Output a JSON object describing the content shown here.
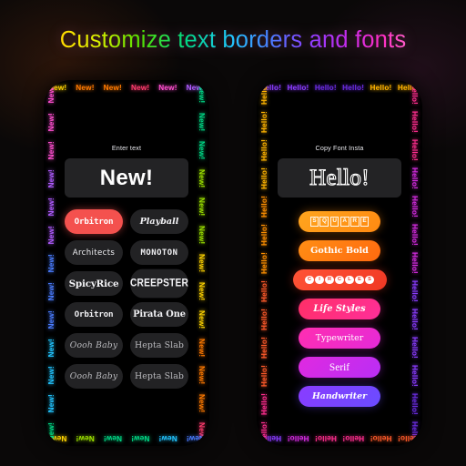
{
  "background_color": "#0a0808",
  "headline": "Customize text borders and fonts",
  "headline_gradient": [
    "#ff5a00",
    "#ffe000",
    "#55e000",
    "#22c4ff",
    "#8a40ff",
    "#ff2ec4",
    "#ffffff"
  ],
  "phones": [
    {
      "name": "left-phone",
      "border_word": "New!",
      "border_palette": [
        "#ff4fd0",
        "#b05cff",
        "#4a7cff",
        "#22c4ff",
        "#00d886",
        "#9be000",
        "#ffd400",
        "#ff7a00",
        "#ff3c6e"
      ],
      "field_label": "Enter text",
      "preview_text": "New!",
      "preview_style": "solid-white",
      "selected_font": "Orbitron",
      "selected_color": "#f4514e",
      "fonts": [
        {
          "label": "Orbitron",
          "style": "f-orbitron",
          "selected": true
        },
        {
          "label": "Playball",
          "style": "f-playball",
          "selected": false
        },
        {
          "label": "Architects",
          "style": "f-architects",
          "selected": false
        },
        {
          "label": "MONOTON",
          "style": "f-monoton",
          "selected": false
        },
        {
          "label": "SpicyRice",
          "style": "f-spicyrice",
          "selected": false
        },
        {
          "label": "CREEPSTER",
          "style": "f-creepster",
          "selected": false
        },
        {
          "label": "Orbitron",
          "style": "f-orbitron",
          "selected": false
        },
        {
          "label": "Pirata One",
          "style": "f-pirata",
          "selected": false
        },
        {
          "label": "Oooh Baby",
          "style": "f-oooh",
          "selected": false
        },
        {
          "label": "Hepta Slab",
          "style": "f-hepta",
          "selected": false
        },
        {
          "label": "Oooh Baby",
          "style": "f-oooh",
          "selected": false
        },
        {
          "label": "Hepta Slab",
          "style": "f-hepta",
          "selected": false
        }
      ]
    },
    {
      "name": "right-phone",
      "border_word": "Hello!",
      "border_palette": [
        "#ffb400",
        "#ff9000",
        "#ff5a2a",
        "#ff2e8e",
        "#d42ce0",
        "#8a3cff",
        "#6a2ce0"
      ],
      "field_label": "Copy Font Insta",
      "preview_text": "Hello!",
      "preview_style": "outlined",
      "styles": [
        {
          "label": "SQUARE",
          "render": "boxed-letters",
          "color_from": "#ffa51e",
          "color_to": "#ff8a12",
          "class": ""
        },
        {
          "label": "Gothic Bold",
          "render": "text",
          "color_from": "#ff8e14",
          "color_to": "#ff6a10",
          "class": "p-gothic"
        },
        {
          "label": "CIRCLES",
          "render": "circled-letters",
          "color_from": "#ff5436",
          "color_to": "#f03824",
          "class": "wide"
        },
        {
          "label": "Life Styles",
          "render": "text",
          "color_from": "#ff2f66",
          "color_to": "#ff2f9a",
          "class": "p-life"
        },
        {
          "label": "Typewriter",
          "render": "text",
          "color_from": "#ff2eb0",
          "color_to": "#e52ad8",
          "class": "p-type"
        },
        {
          "label": "Serif",
          "render": "text",
          "color_from": "#e02ae0",
          "color_to": "#b92ef5",
          "class": "p-serif"
        },
        {
          "label": "Handwriter",
          "render": "text",
          "color_from": "#8a3cff",
          "color_to": "#6a4cff",
          "class": "p-hand"
        }
      ]
    }
  ]
}
